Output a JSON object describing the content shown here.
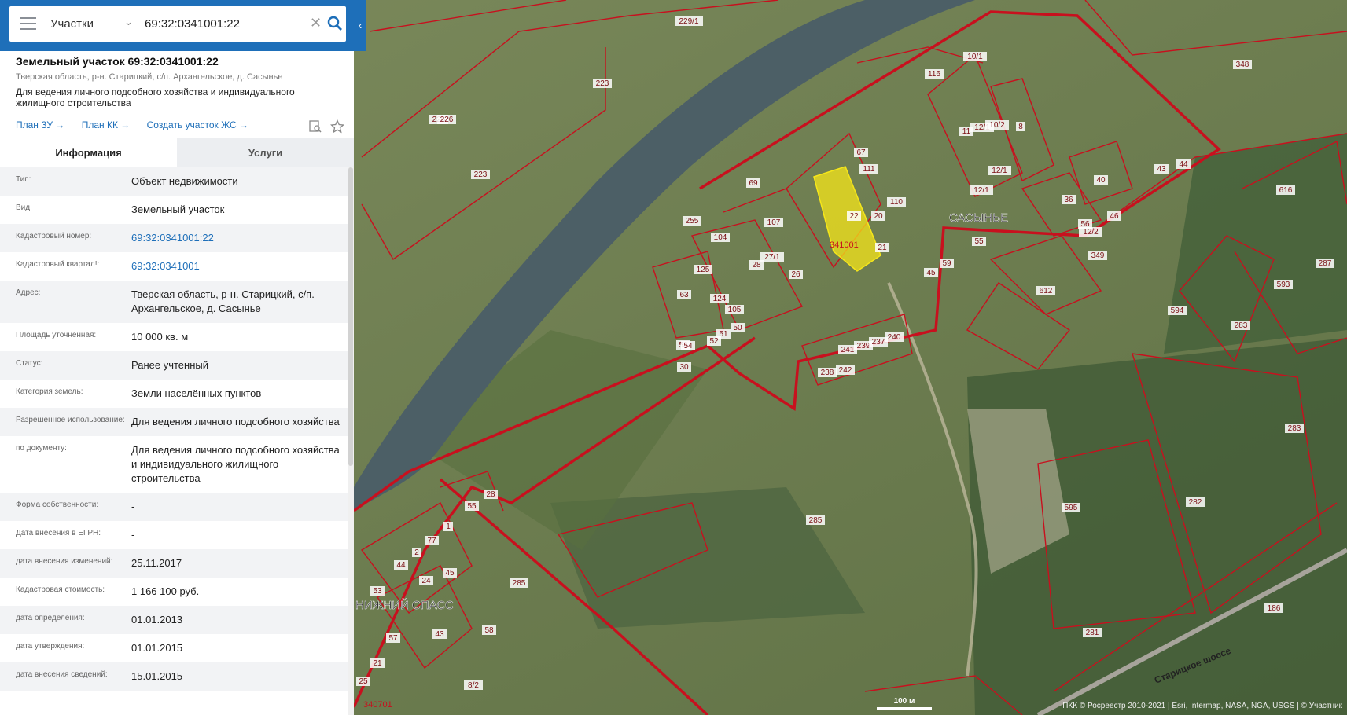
{
  "search": {
    "layer": "Участки",
    "query": "69:32:0341001:22"
  },
  "object": {
    "title": "Земельный участок 69:32:0341001:22",
    "address_line": "Тверская область, р-н. Старицкий, с/п. Архангельское, д. Сасынье",
    "purpose": "Для ведения личного подсобного хозяйства и индивидуального жилищного строительства",
    "links": [
      "План ЗУ →",
      "План КК →",
      "Создать участок ЖС →"
    ]
  },
  "tabs": [
    "Информация",
    "Услуги"
  ],
  "info_rows": [
    {
      "label": "Тип:",
      "value": "Объект недвижимости"
    },
    {
      "label": "Вид:",
      "value": "Земельный участок"
    },
    {
      "label": "Кадастровый номер:",
      "value": "69:32:0341001:22"
    },
    {
      "label": "Кадастровый квартал!:",
      "value": "69:32:0341001"
    },
    {
      "label": "Адрес:",
      "value": "Тверская область, р-н. Старицкий, с/п. Архангельское, д. Сасынье"
    },
    {
      "label": "Площадь уточненная:",
      "value": "10 000 кв. м"
    },
    {
      "label": "Статус:",
      "value": "Ранее учтенный"
    },
    {
      "label": "Категория земель:",
      "value": "Земли населённых пунктов"
    },
    {
      "label": "Разрешенное использование:",
      "value": "Для ведения личного подсобного хозяйства"
    },
    {
      "label": "по документу:",
      "value": "Для ведения личного подсобного хозяйства и индивидуального жилищного строительства"
    },
    {
      "label": "Форма собственности:",
      "value": "-"
    },
    {
      "label": "Дата внесения в ЕГРН:",
      "value": "-"
    },
    {
      "label": "дата внесения изменений:",
      "value": "25.11.2017"
    },
    {
      "label": "Кадастровая стоимость:",
      "value": "1 166 100 руб."
    },
    {
      "label": "дата определения:",
      "value": "01.01.2013"
    },
    {
      "label": "дата утверждения:",
      "value": "01.01.2015"
    },
    {
      "label": "дата внесения сведений:",
      "value": "15.01.2015"
    }
  ],
  "map": {
    "place_labels": [
      "САСЫНЬЕ",
      "НИЖНИЙ СПАСС",
      "Старицкое шоссе"
    ],
    "block_labels": [
      "341001",
      "340701"
    ],
    "parcel_labels": [
      "22",
      "67",
      "111",
      "110",
      "20",
      "21",
      "69",
      "255",
      "104",
      "107",
      "27/1",
      "28",
      "26",
      "125",
      "63",
      "124",
      "105",
      "50",
      "51",
      "52",
      "53",
      "54",
      "30",
      "241",
      "239",
      "237",
      "240",
      "238",
      "242",
      "116",
      "10/1",
      "11",
      "12/1",
      "10/2",
      "8",
      "12/1",
      "12/1",
      "40",
      "43",
      "44",
      "36",
      "56",
      "46",
      "12/2",
      "55",
      "59",
      "45",
      "349",
      "612",
      "594",
      "593",
      "616",
      "287",
      "283",
      "283",
      "282",
      "595",
      "281",
      "186",
      "285",
      "285",
      "226",
      "223",
      "223",
      "226",
      "229/1",
      "348",
      "1",
      "2",
      "77",
      "44",
      "24",
      "45",
      "28",
      "55",
      "53",
      "58",
      "57",
      "21",
      "25",
      "8/2",
      "43",
      "46"
    ],
    "scale": "100 м",
    "attribution": "ПКК © Росреестр 2010-2021 | Esri, Intermap, NASA, NGA, USGS | © Участник"
  },
  "colors": {
    "brand": "#1e6fb9",
    "boundary": "#c8101e",
    "selected": "#f5e61a"
  }
}
